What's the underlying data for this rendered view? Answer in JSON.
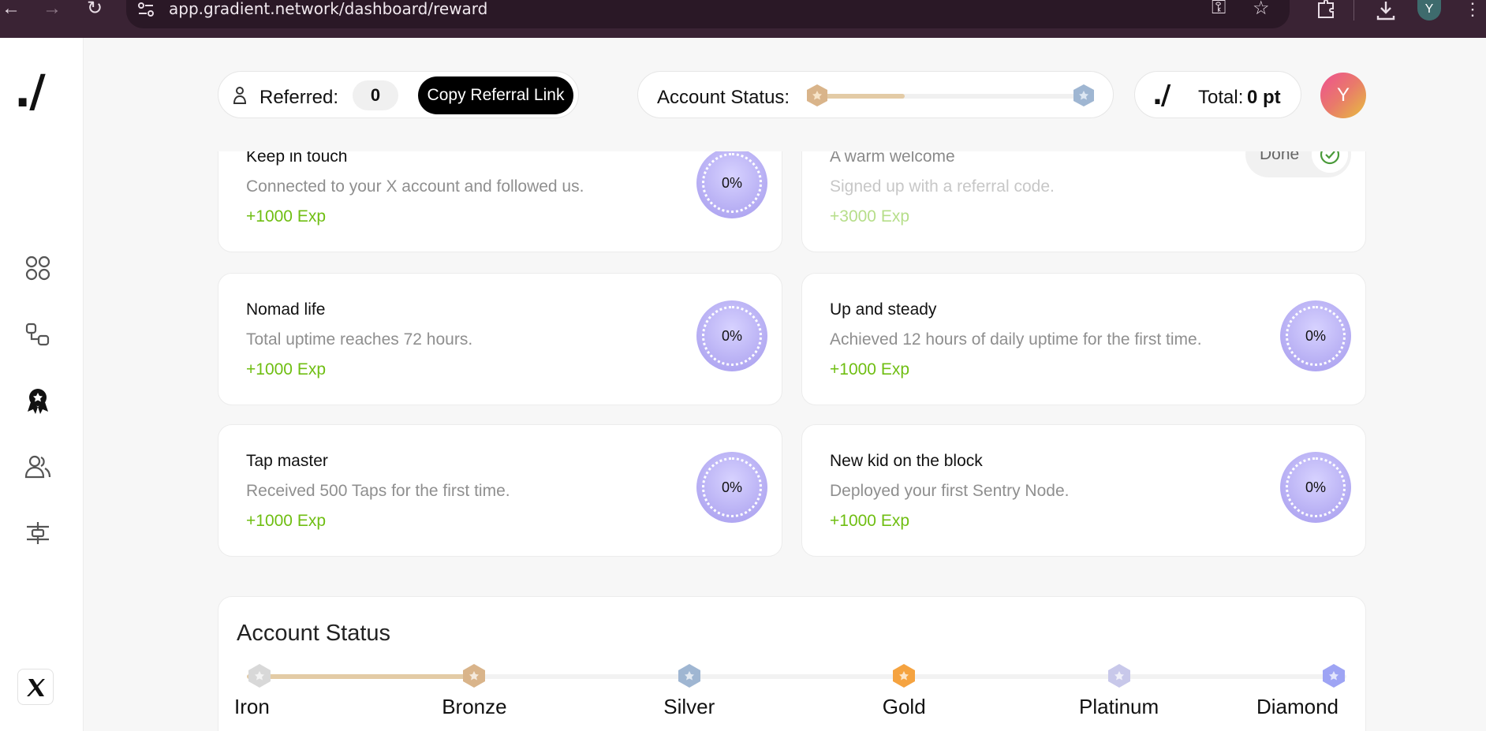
{
  "browser": {
    "url": "app.gradient.network/dashboard/reward",
    "profile_initial": "Y"
  },
  "sidebar": {
    "logo": "./",
    "items": [
      {
        "icon": "dashboard-grid-icon"
      },
      {
        "icon": "nodes-icon"
      },
      {
        "icon": "reward-badge-icon",
        "active": true
      },
      {
        "icon": "users-icon"
      },
      {
        "icon": "settings-sliders-icon"
      }
    ],
    "social_icon": "x-logo-icon"
  },
  "header": {
    "referred_label": "Referred:",
    "referred_count": "0",
    "copy_link_label": "Copy Referral Link",
    "status_label": "Account Status:",
    "status_progress": 0.35,
    "total_logo": "./",
    "total_label": "Total:",
    "total_value": "0 pt",
    "avatar_initial": "Y",
    "colors": {
      "bronze": "#d9b48a",
      "silver": "#9fb6d2",
      "track_fill": "#e3cba6"
    }
  },
  "tasks": [
    {
      "title": "Keep in touch",
      "description": "Connected to your X account and followed us.",
      "reward": "+1000 Exp",
      "progress": "0%"
    },
    {
      "title": "A warm welcome",
      "description": "Signed up with a referral code.",
      "reward": "+3000 Exp",
      "status": "Done"
    },
    {
      "title": "Nomad life",
      "description": "Total uptime reaches 72 hours.",
      "reward": "+1000 Exp",
      "progress": "0%"
    },
    {
      "title": "Up and steady",
      "description": "Achieved 12 hours of daily uptime for the first time.",
      "reward": "+1000 Exp",
      "progress": "0%"
    },
    {
      "title": "Tap master",
      "description": "Received 500 Taps for the first time.",
      "reward": "+1000 Exp",
      "progress": "0%"
    },
    {
      "title": "New kid on the block",
      "description": "Deployed your first Sentry Node.",
      "reward": "+1000 Exp",
      "progress": "0%"
    }
  ],
  "account_status": {
    "title": "Account Status",
    "current_tier_index": 1,
    "tiers": [
      {
        "name": "Iron",
        "color": "#d8d8d8"
      },
      {
        "name": "Bronze",
        "color": "#d9b48a"
      },
      {
        "name": "Silver",
        "color": "#9fb6d2"
      },
      {
        "name": "Gold",
        "color": "#f5a340"
      },
      {
        "name": "Platinum",
        "color": "#c8c8ea"
      },
      {
        "name": "Diamond",
        "color": "#9ea4f4"
      }
    ]
  }
}
